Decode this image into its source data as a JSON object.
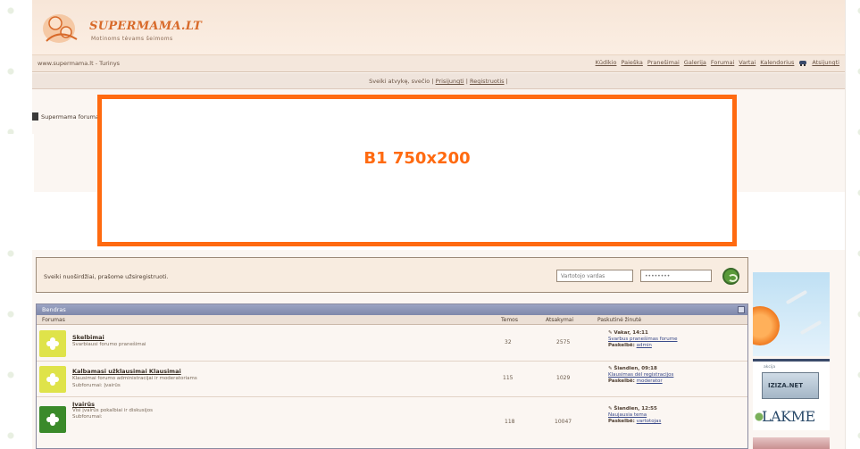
{
  "header": {
    "logo_title": "SUPERMAMA.LT",
    "logo_subtitle": "Motinoms tėvams šeimoms"
  },
  "nav": {
    "left_text": "www.supermama.lt - Turinys",
    "links": [
      "Kūdikio",
      "Paieška",
      "Pranešimai",
      "Galerija",
      "Forumai",
      "Vartai",
      "Kalendorius"
    ],
    "right_link": "Atsijungti"
  },
  "subbar": {
    "text": "Sveiki atvykę, svečio",
    "link1": "Prisijungti",
    "link2": "Registruotis"
  },
  "breadcrumb": "Supermama forumas",
  "banner": {
    "label": "B1 750x200",
    "color": "#ff6a10"
  },
  "login": {
    "text": "Sveiki nuoširdžiai, prašome užsiregistruoti.",
    "username_placeholder": "Vartotojo vardas",
    "password_placeholder": "••••••••"
  },
  "forum_table": {
    "title": "Bendras",
    "headers": {
      "forum": "Forumas",
      "topics": "Temos",
      "posts": "Atsakymai",
      "last_post": "Paskutinė žinutė"
    },
    "rows": [
      {
        "title": "Skelbimai",
        "desc": "Svarbiausi forumo pranešimai",
        "topics": "32",
        "posts": "2575",
        "last_when": "Vakar, 14:11",
        "last_topic": "Svarbus pranešimas forume",
        "last_author_label": "Paskelbė:",
        "last_author": "admin"
      },
      {
        "title": "Kalbamasi užklausimai Klausimai",
        "desc": "Klausimai forumo administracijai ir moderatoriams",
        "sub": "Subforumai: Įvairūs",
        "topics": "115",
        "posts": "1029",
        "last_when": "Šiandien, 09:18",
        "last_topic": "Klausimas dėl registracijos",
        "last_author_label": "Paskelbė:",
        "last_author": "moderator"
      },
      {
        "title": "Įvairūs",
        "desc": "Visi įvairūs pokalbiai ir diskusijos",
        "sub": "Subforumai:",
        "topics": "118",
        "posts": "10047",
        "last_when": "Šiandien, 12:55",
        "last_topic": "Naujausia tema",
        "last_author_label": "Paskelbė:",
        "last_author": "vartotojas"
      }
    ]
  },
  "ads": {
    "lakme_caption": "akcija",
    "lakme_pill": "IZIZA.NET",
    "lakme_brand": "LAKME"
  }
}
